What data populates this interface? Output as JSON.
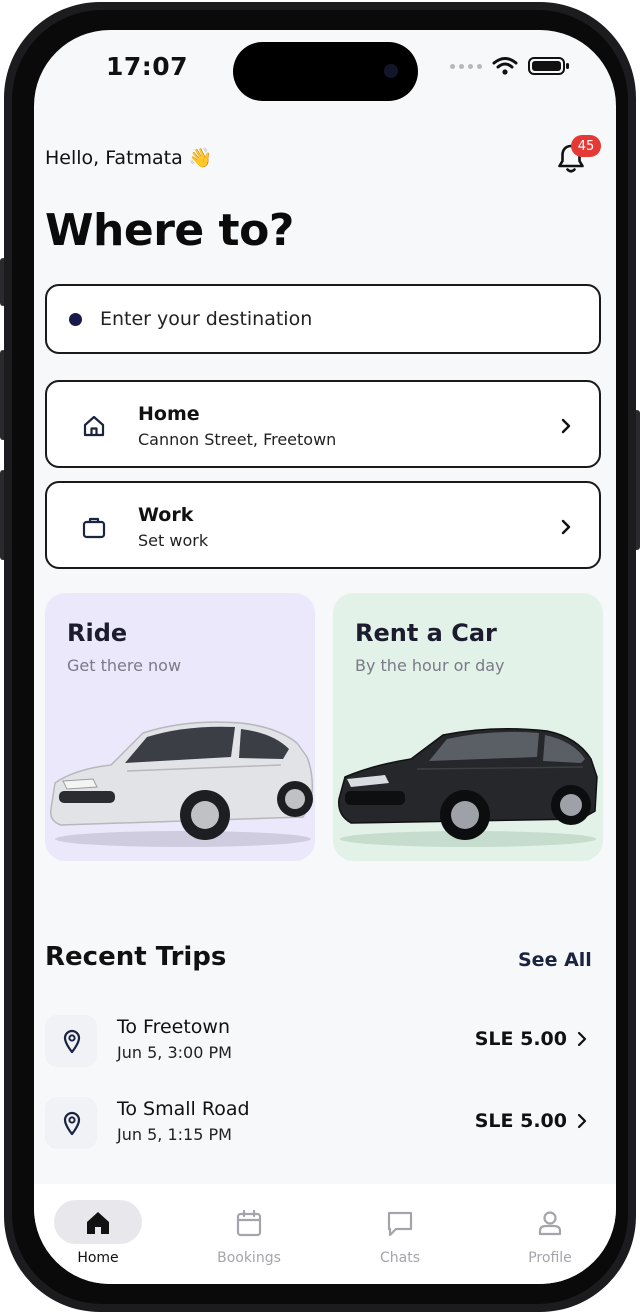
{
  "status_bar": {
    "time": "17:07"
  },
  "header": {
    "greeting": "Hello, Fatmata 👋",
    "notification_count": "45",
    "title": "Where to?"
  },
  "search": {
    "placeholder": "Enter your destination"
  },
  "saved_places": [
    {
      "label": "Home",
      "sub": "Cannon Street, Freetown",
      "icon": "home-icon"
    },
    {
      "label": "Work",
      "sub": "Set work",
      "icon": "briefcase-icon"
    }
  ],
  "services": [
    {
      "title": "Ride",
      "subtitle": "Get there now",
      "bg": "#ebe8fb",
      "car_color": "#d9dadc"
    },
    {
      "title": "Rent a Car",
      "subtitle": "By the hour or day",
      "bg": "#e3f2e8",
      "car_color": "#222426"
    }
  ],
  "recent_trips": {
    "title": "Recent Trips",
    "see_all": "See All",
    "items": [
      {
        "destination": "To Freetown",
        "time": "Jun 5, 3:00 PM",
        "price": "SLE 5.00"
      },
      {
        "destination": "To Small Road",
        "time": "Jun 5, 1:15 PM",
        "price": "SLE 5.00"
      }
    ]
  },
  "bottom_nav": [
    {
      "label": "Home",
      "icon": "home-filled-icon",
      "active": true
    },
    {
      "label": "Bookings",
      "icon": "calendar-icon",
      "active": false
    },
    {
      "label": "Chats",
      "icon": "chat-icon",
      "active": false
    },
    {
      "label": "Profile",
      "icon": "person-icon",
      "active": false
    }
  ],
  "colors": {
    "accent_dark": "#1a2340",
    "badge": "#e53935"
  }
}
